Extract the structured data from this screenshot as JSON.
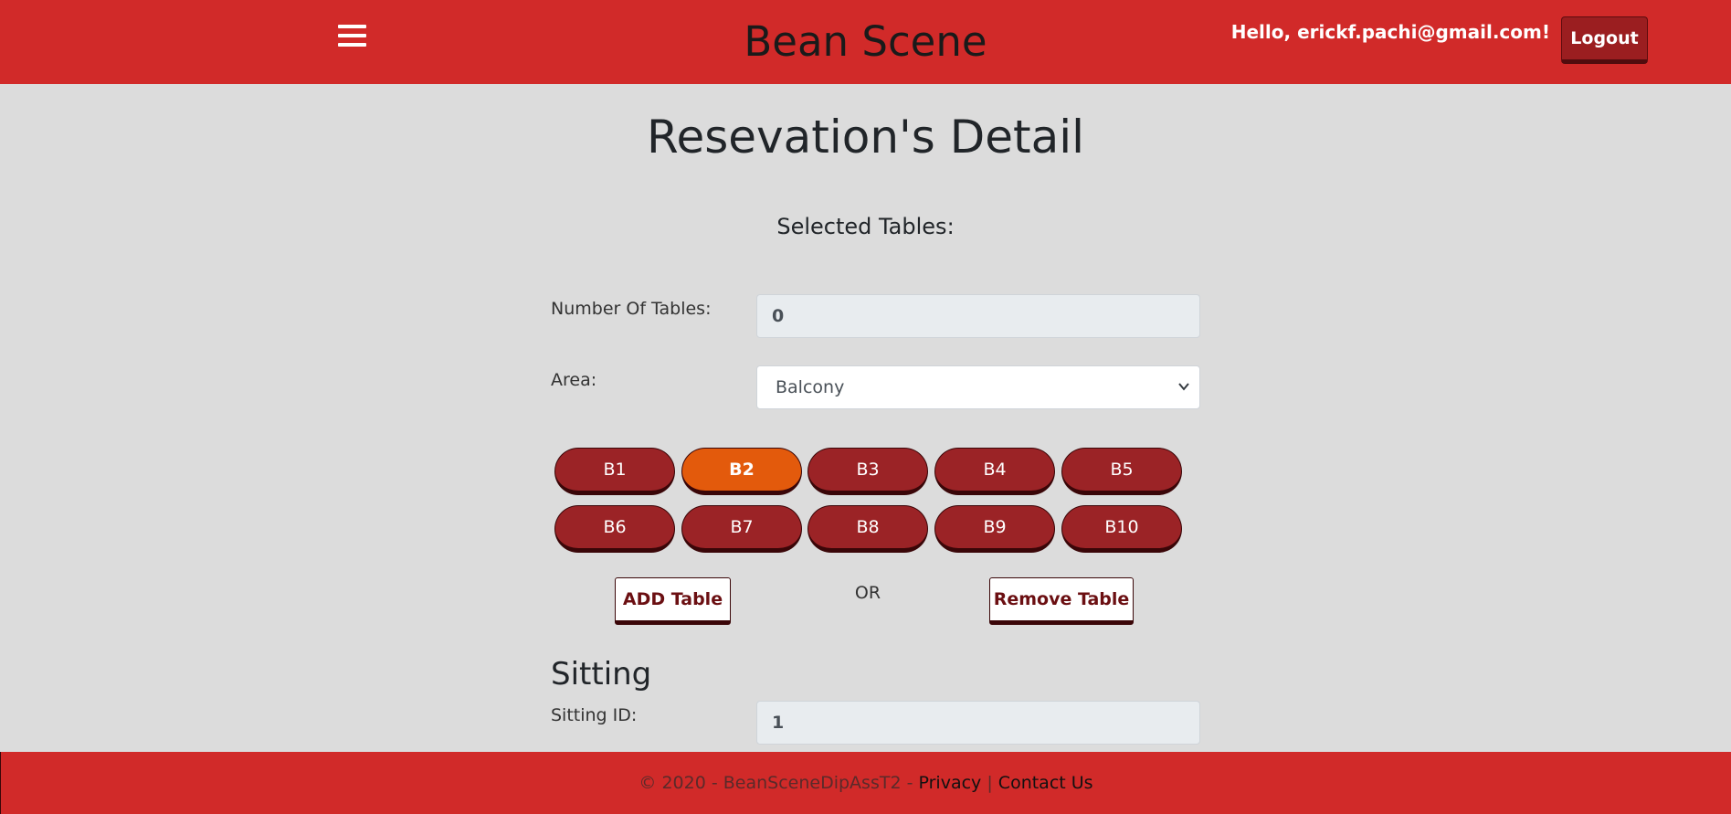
{
  "header": {
    "menu_icon": "hamburger-menu-icon",
    "brand": "Bean Scene",
    "greeting": "Hello, erickf.pachi@gmail.com!",
    "logout_label": "Logout"
  },
  "main": {
    "title": "Resevation's Detail",
    "selected_tables_label": "Selected Tables:",
    "number_of_tables": {
      "label": "Number Of Tables:",
      "value": "0"
    },
    "area": {
      "label": "Area:",
      "selected": "Balcony",
      "icon": "chevron-down-icon"
    },
    "tables": [
      "B1",
      "B2",
      "B3",
      "B4",
      "B5",
      "B6",
      "B7",
      "B8",
      "B9",
      "B10"
    ],
    "active_table": "B2",
    "add_table_label": "ADD Table",
    "or_label": "OR",
    "remove_table_label": "Remove Table",
    "sitting": {
      "title": "Sitting",
      "sitting_id": {
        "label": "Sitting ID:",
        "value": "1"
      }
    }
  },
  "footer": {
    "copyright": "© 2020 - BeanSceneDipAssT2 -",
    "privacy_label": "Privacy",
    "separator": "|",
    "contact_label": "Contact Us"
  },
  "colors": {
    "header_bg": "#d12a29",
    "page_bg": "#dcdcdc",
    "table_button": "#9b2326",
    "table_button_active": "#e35a0c",
    "logout_bg": "#9b1e20"
  }
}
